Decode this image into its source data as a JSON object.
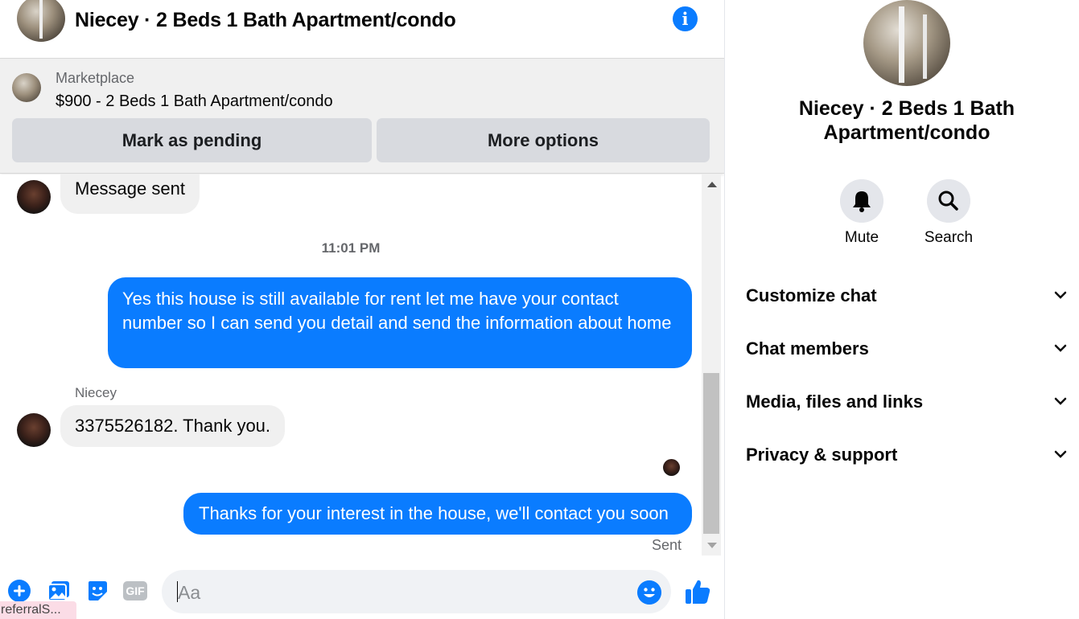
{
  "header": {
    "title": "Niecey · 2 Beds 1 Bath Apartment/condo"
  },
  "marketplace": {
    "label": "Marketplace",
    "price_line": "$900 - 2 Beds 1 Bath Apartment/condo",
    "mark_pending": "Mark as pending",
    "more_options": "More options"
  },
  "messages": {
    "first_in": "Message sent",
    "timestamp": "11:01 PM",
    "out_1": "Yes this house is still available for rent let me have your contact number so I can send you detail and send the information about home",
    "sender": "Niecey",
    "in_2": "3375526182. Thank you.",
    "out_2": "Thanks for your interest in the house, we'll contact you soon",
    "status": "Sent"
  },
  "composer": {
    "placeholder": "Aa",
    "gif_label": "GIF",
    "referral": "referralS..."
  },
  "panel": {
    "name": "Niecey · 2 Beds 1 Bath Apartment/condo",
    "mute": "Mute",
    "search": "Search",
    "sections": [
      "Customize chat",
      "Chat members",
      "Media, files and links",
      "Privacy & support"
    ]
  },
  "colors": {
    "accent": "#0a7cff",
    "bubble_in": "#f0f0f0",
    "button_gray": "#d8dadf"
  }
}
